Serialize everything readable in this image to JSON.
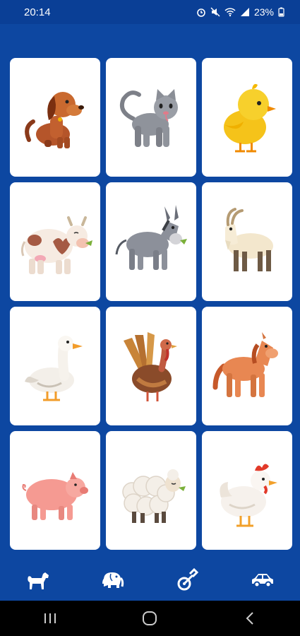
{
  "status_bar": {
    "time": "20:14",
    "battery": "23%",
    "icons": [
      "alarm-icon",
      "mute-icon",
      "wifi-icon",
      "signal-icon",
      "battery-icon"
    ]
  },
  "colors": {
    "background": "#0d47a1",
    "card": "#ffffff",
    "nav_icon": "#ffffff"
  },
  "animal_cards": [
    {
      "animal": "dog"
    },
    {
      "animal": "cat"
    },
    {
      "animal": "chick"
    },
    {
      "animal": "cow"
    },
    {
      "animal": "donkey"
    },
    {
      "animal": "goat"
    },
    {
      "animal": "goose"
    },
    {
      "animal": "turkey"
    },
    {
      "animal": "horse"
    },
    {
      "animal": "pig"
    },
    {
      "animal": "sheep"
    },
    {
      "animal": "hen"
    }
  ],
  "bottom_nav": [
    {
      "icon": "dog-icon"
    },
    {
      "icon": "elephant-icon"
    },
    {
      "icon": "guitar-icon"
    },
    {
      "icon": "car-icon"
    }
  ],
  "system_nav": [
    {
      "icon": "recent-apps-icon"
    },
    {
      "icon": "home-icon"
    },
    {
      "icon": "back-icon"
    }
  ]
}
